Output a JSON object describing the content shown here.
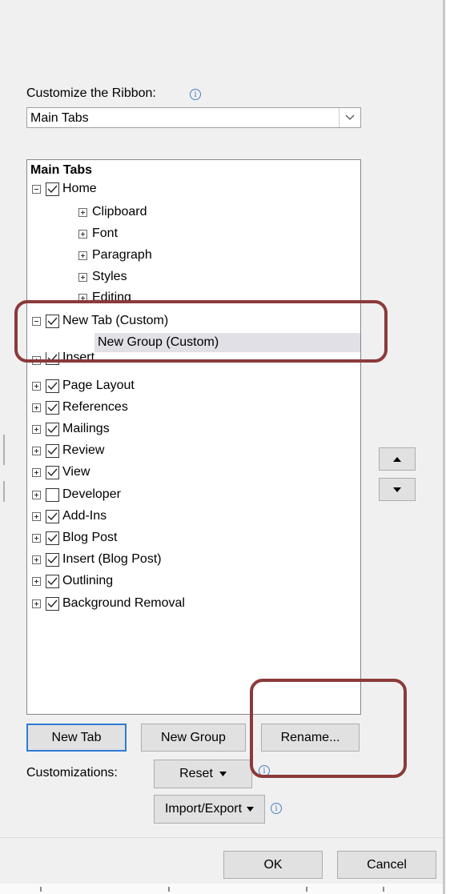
{
  "customize_ribbon": {
    "label": "Customize the Ribbon:",
    "info_icon": "info-icon",
    "dropdown_value": "Main Tabs"
  },
  "tree": {
    "header": "Main Tabs",
    "items": [
      {
        "label": "Home",
        "expanded": true,
        "checked": true
      },
      {
        "label": "Clipboard",
        "level": 1
      },
      {
        "label": "Font",
        "level": 1
      },
      {
        "label": "Paragraph",
        "level": 1
      },
      {
        "label": "Styles",
        "level": 1
      },
      {
        "label": "Editing",
        "level": 1
      },
      {
        "label": "New Tab (Custom)",
        "expanded": true,
        "checked": true
      },
      {
        "label": "New Group (Custom)",
        "level": 1,
        "selected": true
      },
      {
        "label": "Insert",
        "checked": true
      },
      {
        "label": "Page Layout",
        "checked": true
      },
      {
        "label": "References",
        "checked": true
      },
      {
        "label": "Mailings",
        "checked": true
      },
      {
        "label": "Review",
        "checked": true
      },
      {
        "label": "View",
        "checked": true
      },
      {
        "label": "Developer",
        "checked": false
      },
      {
        "label": "Add-Ins",
        "checked": true
      },
      {
        "label": "Blog Post",
        "checked": true
      },
      {
        "label": "Insert (Blog Post)",
        "checked": true
      },
      {
        "label": "Outlining",
        "checked": true
      },
      {
        "label": "Background Removal",
        "checked": true
      }
    ]
  },
  "buttons": {
    "new_tab": "New Tab",
    "new_group": "New Group",
    "rename": "Rename...",
    "reset": "Reset",
    "import_export": "Import/Export",
    "ok": "OK",
    "cancel": "Cancel"
  },
  "customizations_label": "Customizations:",
  "colors": {
    "highlight": "#8b3a3a",
    "default_button_border": "#2e7bd6",
    "selection": "#e0e0e6"
  }
}
